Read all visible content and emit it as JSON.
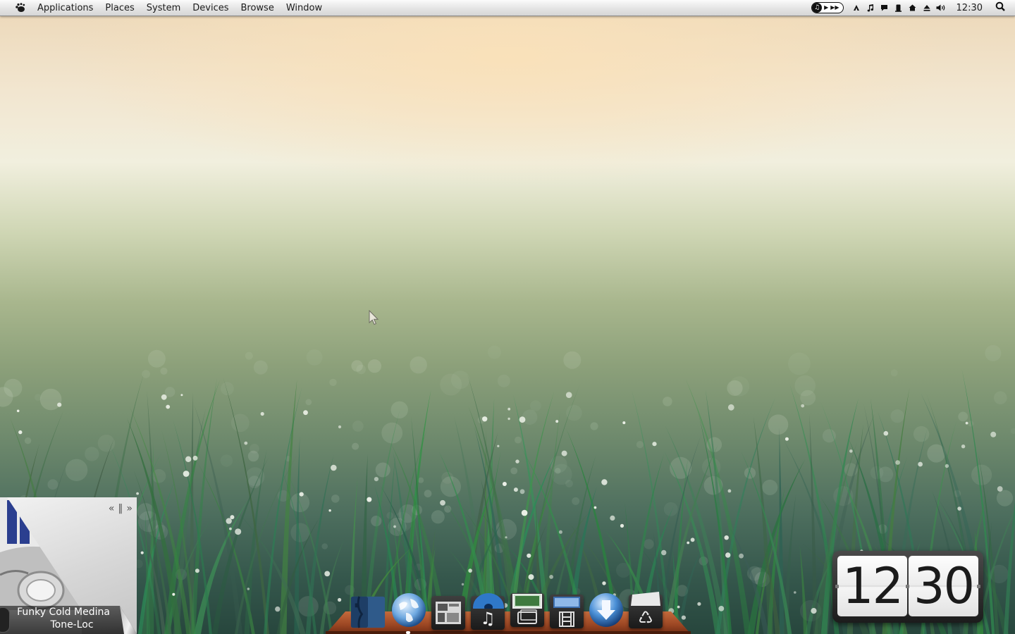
{
  "menubar": {
    "logo_icon": "gnome-foot-icon",
    "menus": [
      "Applications",
      "Places",
      "System",
      "Devices",
      "Browse",
      "Window"
    ],
    "tray_icons": [
      "media-controls-icon",
      "triangle-up-icon",
      "music-note-icon",
      "chat-bubble-icon",
      "phone-icon",
      "home-icon",
      "eject-icon",
      "volume-icon"
    ],
    "clock": "12:30",
    "search_icon": "search-icon"
  },
  "music_widget": {
    "song": "Funky Cold Medina",
    "artist": "Tone-Loc",
    "controls": {
      "previous": "«",
      "pause": "‖",
      "next": "»"
    }
  },
  "dock": {
    "items": [
      {
        "name": "file-manager",
        "icon": "finder-icon",
        "glyph": ""
      },
      {
        "name": "web-browser",
        "icon": "globe-icon",
        "glyph": ""
      },
      {
        "name": "system-panel",
        "icon": "dashboard-icon",
        "glyph": ""
      },
      {
        "name": "music",
        "icon": "music-note-icon",
        "glyph": "♫"
      },
      {
        "name": "photos",
        "icon": "photo-icon",
        "glyph": ""
      },
      {
        "name": "videos",
        "icon": "film-icon",
        "glyph": ""
      },
      {
        "name": "downloads",
        "icon": "download-icon",
        "glyph": ""
      },
      {
        "name": "trash",
        "icon": "recycle-icon",
        "glyph": "♺"
      }
    ]
  },
  "flip_clock": {
    "hours": "12",
    "minutes": "30"
  },
  "colors": {
    "menubar": "#e4e4e4",
    "dock_shelf": "#9b4623",
    "sky_top": "#ecd7b7",
    "grass_bottom": "#27463d"
  }
}
